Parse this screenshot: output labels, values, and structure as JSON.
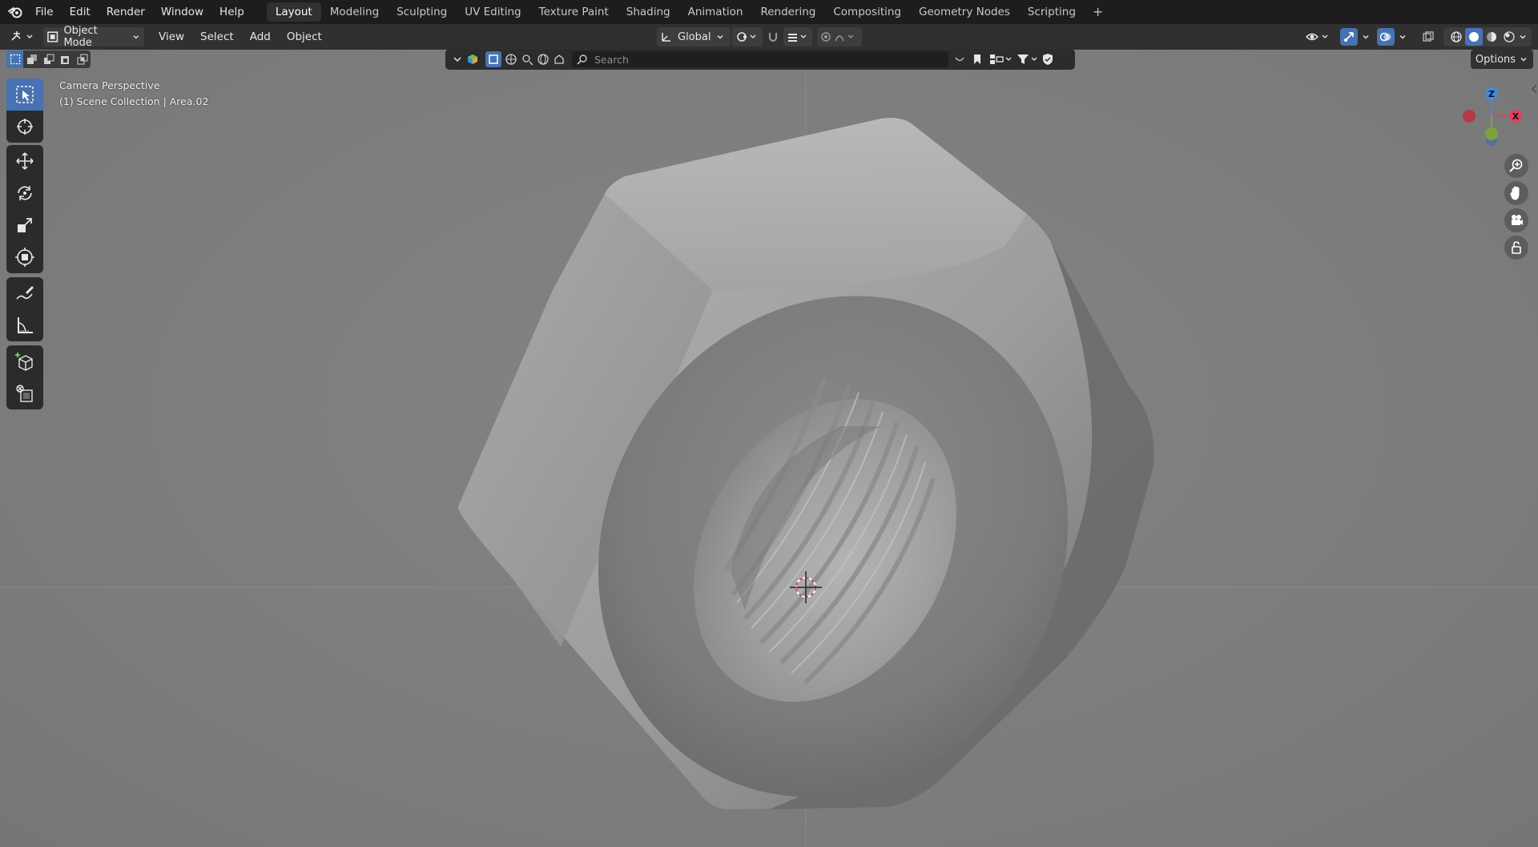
{
  "menubar": {
    "items": [
      "File",
      "Edit",
      "Render",
      "Window",
      "Help"
    ]
  },
  "workspaces": {
    "tabs": [
      "Layout",
      "Modeling",
      "Sculpting",
      "UV Editing",
      "Texture Paint",
      "Shading",
      "Animation",
      "Rendering",
      "Compositing",
      "Geometry Nodes",
      "Scripting"
    ],
    "active": "Layout"
  },
  "header": {
    "mode": "Object Mode",
    "menus": [
      "View",
      "Select",
      "Add",
      "Object"
    ],
    "orientation": "Global"
  },
  "viewport": {
    "camera_label": "Camera Perspective",
    "collection_label": "(1) Scene Collection | Area.02",
    "options_label": "Options",
    "search_placeholder": "Search",
    "background_color": "#7e7e7e",
    "object": "hex-nut",
    "gizmo_axes": {
      "x": "X",
      "z": "Z"
    }
  },
  "colors": {
    "accent": "#4772b3",
    "axis_x": "#e0415b",
    "axis_y": "#7ea33a",
    "axis_z": "#3d8ee0"
  }
}
